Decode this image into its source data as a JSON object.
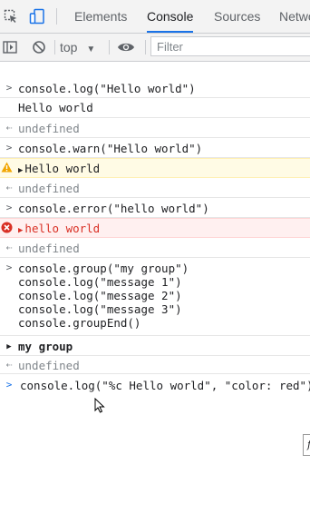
{
  "toolbar": {
    "tabs": [
      {
        "label": "Elements",
        "active": false
      },
      {
        "label": "Console",
        "active": true
      },
      {
        "label": "Sources",
        "active": false
      },
      {
        "label": "Network",
        "active": false
      }
    ],
    "context_label": "top",
    "filter_placeholder": "Filter"
  },
  "console": {
    "entries": [
      {
        "kind": "input",
        "text": "console.log(\"Hello world\")"
      },
      {
        "kind": "output",
        "text": "Hello world"
      },
      {
        "kind": "result",
        "text": "undefined"
      },
      {
        "kind": "input",
        "text": "console.warn(\"Hello world\")"
      },
      {
        "kind": "warning",
        "text": "Hello world"
      },
      {
        "kind": "result",
        "text": "undefined"
      },
      {
        "kind": "input",
        "text": "console.error(\"hello world\")"
      },
      {
        "kind": "error",
        "text": "hello world"
      },
      {
        "kind": "result",
        "text": "undefined"
      },
      {
        "kind": "input-multi",
        "lines": [
          "console.group(\"my group\")",
          "console.log(\"message 1\")",
          "console.log(\"message 2\")",
          "console.log(\"message 3\")",
          "console.groupEnd()"
        ]
      },
      {
        "kind": "group",
        "text": "my group"
      },
      {
        "kind": "result",
        "text": "undefined"
      }
    ],
    "prompt_value": "console.log(\"%c Hello world\", \"color: red\")",
    "tooltip_glyph": "f"
  },
  "colors": {
    "accent": "#1a73e8",
    "warning_bg": "#fffbe5",
    "error_bg": "#fff0f0",
    "warning_icon": "#f2a600",
    "error_icon": "#d93025"
  }
}
